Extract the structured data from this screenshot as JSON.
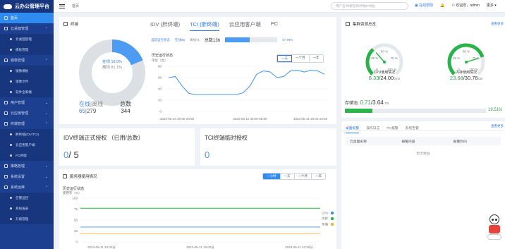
{
  "app": {
    "title": "云办公管理平台"
  },
  "sidebar": {
    "items": [
      {
        "label": "首页",
        "active": true,
        "level": 0
      },
      {
        "label": "云桌面管理",
        "level": 0,
        "open": true
      },
      {
        "label": "云桌面管理",
        "level": 1
      },
      {
        "label": "模板管理",
        "level": 1
      },
      {
        "label": "镜像管理",
        "level": 0,
        "open": true
      },
      {
        "label": "镜像模板",
        "level": 1
      },
      {
        "label": "镜像文件",
        "level": 1
      },
      {
        "label": "软件全家桶",
        "level": 1
      },
      {
        "label": "用户管理",
        "level": 0
      },
      {
        "label": "云应用管理",
        "level": 0
      },
      {
        "label": "终端管理",
        "level": 0,
        "open": true
      },
      {
        "label": "胖终端(IDV/TCI)",
        "level": 1
      },
      {
        "label": "云应用客户端",
        "level": 1
      },
      {
        "label": "PC终端",
        "level": 1
      },
      {
        "label": "策略管理",
        "level": 0
      },
      {
        "label": "系统设置",
        "level": 0
      },
      {
        "label": "系统运维",
        "level": 0,
        "open": true
      },
      {
        "label": "告警监控",
        "level": 1
      },
      {
        "label": "系统报表",
        "level": 1
      },
      {
        "label": "升级管理",
        "level": 1
      }
    ]
  },
  "topbar": {
    "breadcrumb": "首页",
    "search_placeholder": "用户名/终端名称/终端IP地址",
    "help": "在线帮助",
    "user": "欢迎您，admin",
    "more": "更多"
  },
  "overview": {
    "title": "终端",
    "online_legend": "在线 18.9%",
    "offline_legend": "离线 81.1%",
    "online_label": "在线",
    "offline_label": "离线",
    "online_count": "65",
    "offline_count": "279",
    "total_label": "总数",
    "total_count": "344",
    "online_pct": 18.9
  },
  "terminal_tabs": [
    "IDV (胖终端)",
    "TCI (胖终端)",
    "云应用客户端",
    "PC"
  ],
  "terminal_tab_active": 1,
  "tci": {
    "state_label": "当前运行状态",
    "online": "在线65",
    "offline": "离线71",
    "total": "总数136",
    "percent": "47.79%",
    "percent_value": 47.79
  },
  "history": {
    "title": "历史运行状态",
    "unit": "单位（台）",
    "ranges": [
      "一天",
      "一个月",
      "一年"
    ],
    "range_active": 0
  },
  "chart_data": [
    {
      "type": "line",
      "title": "历史运行状态",
      "ylabel": "单位（台）",
      "ylim": [
        0,
        80
      ],
      "yticks": [
        0,
        20,
        40,
        60,
        80
      ],
      "x_ticks": [
        "2023-05-10 20:00-20:59",
        "2023-05-11 08:00-08:59",
        "2023-05-11 19:00-19:59"
      ],
      "x": [
        0,
        1,
        2,
        3,
        4,
        5,
        6,
        7,
        8,
        9,
        10,
        11,
        12,
        13,
        14,
        15,
        16,
        17,
        18,
        19,
        20,
        21,
        22,
        23
      ],
      "series": [
        {
          "values": [
            60,
            62,
            45,
            32,
            30,
            30,
            30,
            30,
            30,
            30,
            30,
            33,
            45,
            66,
            72,
            70,
            60,
            62,
            72,
            73,
            70,
            73,
            72,
            66
          ]
        }
      ],
      "grid": true
    },
    {
      "type": "line",
      "title": "历史运行状态",
      "ylabel": "使用率（%）",
      "ylim": [
        0,
        100
      ],
      "yticks": [
        0,
        25,
        50,
        75,
        100
      ],
      "grid": true,
      "legend": "right",
      "series": [
        {
          "name": "CPU",
          "color": "#3b8ef0",
          "values": [
            34,
            34,
            34,
            34,
            34,
            34,
            34,
            34,
            34,
            34,
            34,
            34,
            34,
            34,
            34,
            34,
            34,
            34,
            34,
            34
          ]
        },
        {
          "name": "内存",
          "color": "#27b34a",
          "values": [
            77,
            77,
            77,
            77,
            77,
            77,
            77,
            77,
            77,
            77,
            77,
            77,
            77,
            77,
            77,
            77,
            77,
            77,
            77,
            77
          ]
        },
        {
          "name": "存储",
          "color": "#f2b33d",
          "values": [
            19,
            19,
            19,
            19,
            19,
            19,
            19,
            19,
            19,
            19,
            19,
            19,
            19,
            19,
            19,
            19,
            19,
            19,
            19,
            19
          ]
        }
      ],
      "x_ticks": [
        "2023-05-11 10:00分",
        "2023-05-11 10:00分",
        "2023-05-11 10:00分"
      ]
    }
  ],
  "idv_auth": {
    "title": "IDV终端正式授权 （已用/总数）",
    "used": "0",
    "total": "/ 5"
  },
  "tci_auth": {
    "title": "TCI终端临时授权",
    "value": "0"
  },
  "server_usage": {
    "title": "服务器使用情况",
    "ranges": [
      "一小时",
      "一天",
      "一个月",
      "一年"
    ],
    "range_active": 0,
    "chart_title": "历史运行状态",
    "unit": "使用率（%）"
  },
  "resources": {
    "title": "集群资源总览",
    "more": "查看更多",
    "cpu": {
      "label": "CPU使用情况",
      "used": "8.33",
      "total": "/24.00",
      "unit": "GHz",
      "gauge_pct": 34.7
    },
    "mem": {
      "label": "内存使用情况",
      "used": "23.68",
      "total": "/30.76",
      "unit": "GB",
      "gauge_pct": 77
    },
    "gauge_ticks": [
      "0",
      "25 %",
      "50 %",
      "75 %",
      "100 %"
    ],
    "storage": {
      "label": "存储池:",
      "used": "0.71",
      "total": "/3.64",
      "unit": "TB",
      "percent": "19.51%",
      "percent_value": 19.51
    }
  },
  "alerts": {
    "tabs": [
      "桌面报警",
      "操作日志",
      "PC报警",
      "系统告警"
    ],
    "tab_active": 0,
    "more": "查看更多",
    "columns": [
      "云桌面名称",
      "报警内容",
      "报警时间"
    ],
    "empty": "暂无数据"
  }
}
